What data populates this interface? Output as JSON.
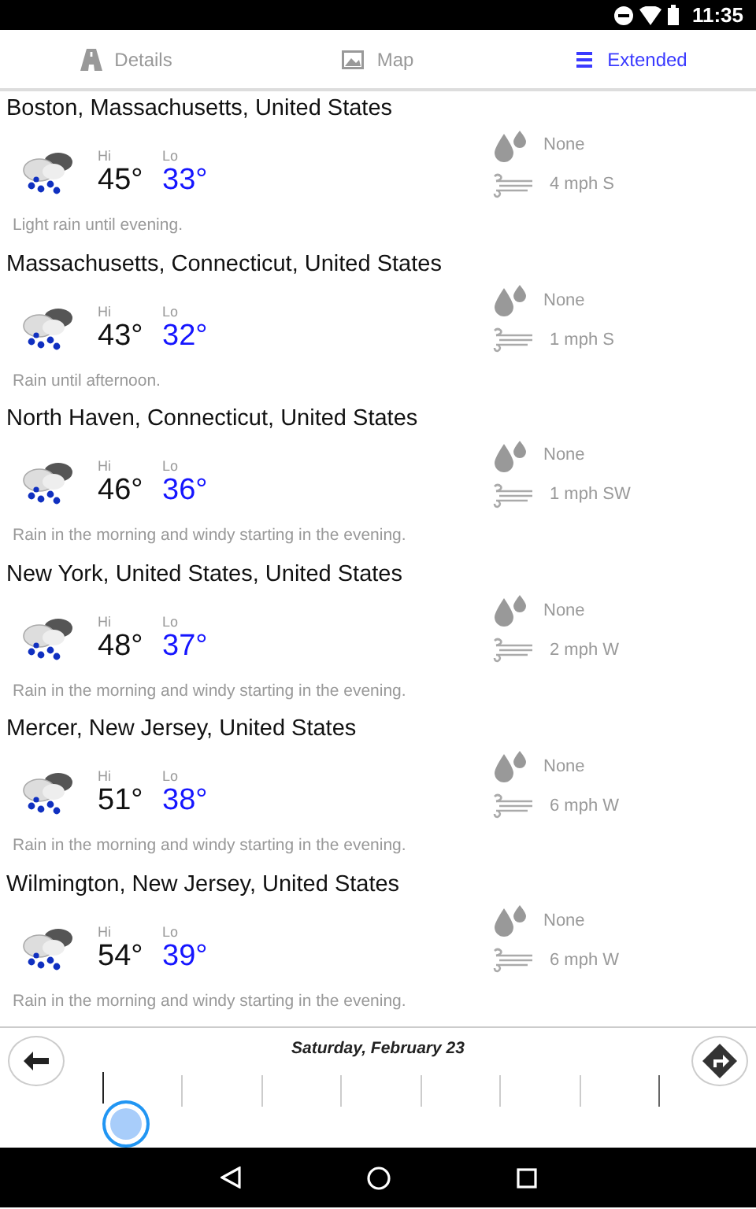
{
  "status_bar": {
    "time": "11:35"
  },
  "tabs": [
    {
      "label": "Details",
      "kind": "road",
      "selected": false
    },
    {
      "label": "Map",
      "kind": "image",
      "selected": false
    },
    {
      "label": "Extended",
      "kind": "list",
      "selected": true
    }
  ],
  "locations": [
    {
      "name": "Boston, Massachusetts, United States",
      "hi_label": "Hi",
      "lo_label": "Lo",
      "hi": "45°",
      "lo": "33°",
      "precip": "None",
      "wind": "4 mph S",
      "summary": "Light rain until evening."
    },
    {
      "name": "Massachusetts, Connecticut, United States",
      "hi_label": "Hi",
      "lo_label": "Lo",
      "hi": "43°",
      "lo": "32°",
      "precip": "None",
      "wind": "1 mph S",
      "summary": "Rain until afternoon."
    },
    {
      "name": "North Haven, Connecticut, United States",
      "hi_label": "Hi",
      "lo_label": "Lo",
      "hi": "46°",
      "lo": "36°",
      "precip": "None",
      "wind": "1 mph SW",
      "summary": "Rain in the morning and windy starting in the evening."
    },
    {
      "name": "New York, United States, United States",
      "hi_label": "Hi",
      "lo_label": "Lo",
      "hi": "48°",
      "lo": "37°",
      "precip": "None",
      "wind": "2 mph W",
      "summary": "Rain in the morning and windy starting in the evening."
    },
    {
      "name": "Mercer, New Jersey, United States",
      "hi_label": "Hi",
      "lo_label": "Lo",
      "hi": "51°",
      "lo": "38°",
      "precip": "None",
      "wind": "6 mph W",
      "summary": "Rain in the morning and windy starting in the evening."
    },
    {
      "name": "Wilmington, New Jersey, United States",
      "hi_label": "Hi",
      "lo_label": "Lo",
      "hi": "54°",
      "lo": "39°",
      "precip": "None",
      "wind": "6 mph W",
      "summary": "Rain in the morning and windy starting in the evening."
    }
  ],
  "timeline": {
    "date": "Saturday, February 23",
    "level": 0
  }
}
